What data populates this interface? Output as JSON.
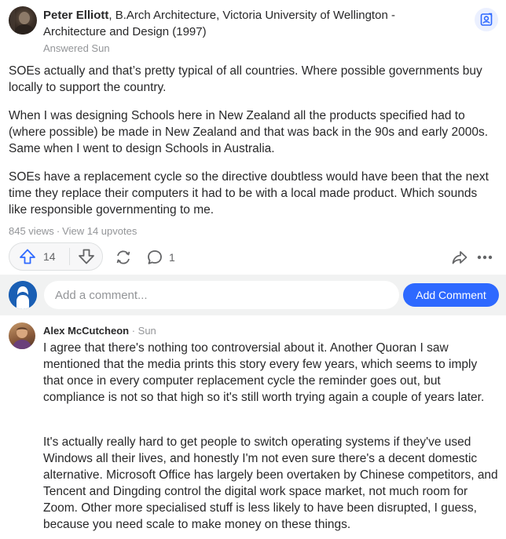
{
  "answer": {
    "author_name": "Peter Elliott",
    "credential": ", B.Arch Architecture, Victoria University of Wellington - Architecture and Design (1997)",
    "answered": "Answered Sun",
    "paragraphs": [
      "SOEs actually and that’s pretty typical of all countries. Where possible governments buy locally to support the country.",
      "When I was designing Schools here in New Zealand all the products specified had to (where possible) be made in New Zealand and that was back in the 90s and early 2000s. Same when I went to design Schools in Australia.",
      "SOEs have a replacement cycle so the directive doubtless would have been that the next time they replace their computers it had to be with a local made product. Which sounds like responsible governmenting to me."
    ],
    "views": "845 views",
    "separator": "·",
    "upvotes": "View 14 upvotes",
    "upvote_count": "14",
    "comment_count": "1"
  },
  "comment_box": {
    "placeholder": "Add a comment...",
    "button_label": "Add Comment"
  },
  "comment": {
    "author": "Alex McCutcheon",
    "time": "· Sun",
    "paragraphs": [
      "I agree that there's nothing too controversial about it. Another Quoran I saw mentioned that the media prints this story every few years, which seems to imply that once in every computer replacement cycle the reminder goes out, but compliance is not so that high so it's still worth trying again a couple of years later.",
      "It's actually really hard to get people to switch operating systems if they've used Windows all their lives, and honestly I'm not even sure there's a decent domestic alternative. Microsoft Office has largely been overtaken by Chinese competitors, and Tencent and Dingding control the digital work space market, not much room for Zoom. Other more specialised stuff is less likely to have been disrupted, I guess, because you need scale to make money on these things."
    ]
  },
  "colors": {
    "accent": "#2e69ff",
    "upvote": "#2e69ff",
    "muted_text": "#939598",
    "body_text": "#282829",
    "comment_bar_bg": "#f1f2f2"
  },
  "icons": {
    "top_right": "person-badge-icon",
    "upvote": "upvote-arrow-icon",
    "downvote": "downvote-arrow-icon",
    "share": "share-cycle-icon",
    "comment": "comment-bubble-icon",
    "forward": "forward-arrow-icon",
    "more": "more-dots-icon"
  }
}
